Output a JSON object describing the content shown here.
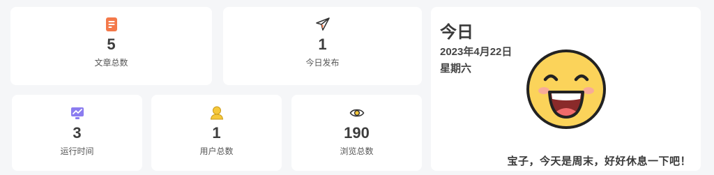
{
  "stats": {
    "articles": {
      "value": "5",
      "label": "文章总数",
      "icon": "document-icon"
    },
    "today": {
      "value": "1",
      "label": "今日发布",
      "icon": "paper-plane-icon"
    },
    "runtime": {
      "value": "3",
      "label": "运行时间",
      "icon": "monitor-chart-icon"
    },
    "users": {
      "value": "1",
      "label": "用户总数",
      "icon": "user-icon"
    },
    "views": {
      "value": "190",
      "label": "浏览总数",
      "icon": "eye-icon"
    }
  },
  "date_card": {
    "title": "今日",
    "date": "2023年4月22日",
    "weekday": "星期六",
    "icon": "smiley-face-icon",
    "greeting": "宝子，今天是周末，好好休息一下吧！"
  },
  "colors": {
    "page_bg": "#f5f6f8",
    "card_bg": "#ffffff",
    "doc_icon": "#f4794a",
    "monitor_icon": "#8b7cf0",
    "user_icon": "#f6c83a",
    "emoji_face": "#fbd35a"
  }
}
